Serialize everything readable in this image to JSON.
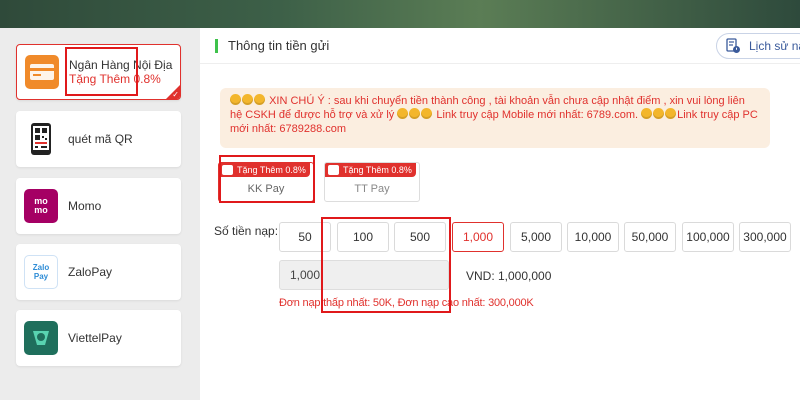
{
  "sidebar": {
    "items": [
      {
        "label": "Ngân Hàng Nội Địa",
        "sub": "Tặng Thêm 0.8%",
        "icon": "bank-card-icon"
      },
      {
        "label": "quét mã QR",
        "icon": "qr-phone-icon"
      },
      {
        "label": "Momo",
        "icon": "momo-icon",
        "logo_text": "mo mo"
      },
      {
        "label": "ZaloPay",
        "icon": "zalopay-icon",
        "logo_text": "Zalo Pay"
      },
      {
        "label": "ViettelPay",
        "icon": "viettelpay-icon"
      }
    ]
  },
  "header": {
    "title": "Thông tin tiền gửi",
    "history_label": "Lịch sử nạ"
  },
  "notice": {
    "text": "XIN CHÚ Ý : sau khi chuyển tiền thành công , tài khoản vẫn chưa cập nhật điểm , xin vui lòng liên hệ CSKH để được hỗ trợ và xử lý",
    "text2": "Link truy cập Mobile mới nhất: 6789.com.",
    "text3": "Link truy cập PC mới nhất: 6789288.com"
  },
  "pay_options": [
    {
      "name": "KK Pay",
      "tag": "Tặng Thêm 0.8%"
    },
    {
      "name": "TT Pay",
      "tag": "Tặng Thêm 0.8%"
    }
  ],
  "amount": {
    "label": "Số tiền nạp:",
    "chips": [
      "50",
      "100",
      "500",
      "1,000",
      "5,000",
      "10,000",
      "50,000",
      "100,000",
      "300,000"
    ],
    "selected": "1,000",
    "input_value": "1,000",
    "vnd_text": "VND: 1,000,000",
    "limit_text": "Đơn nạp thấp nhất: 50K, Đơn nạp cao nhất: 300,000K"
  },
  "colors": {
    "accent_red": "#e0312d",
    "accent_green": "#3ec24b",
    "notice_bg": "#fbeee0",
    "momo": "#a50064",
    "zalopay": "#2e8cd6",
    "viettelpay": "#1f6f5c",
    "bank": "#f08a2a"
  }
}
